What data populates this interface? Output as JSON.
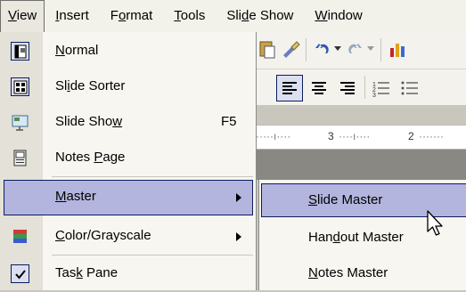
{
  "menubar": {
    "items": [
      {
        "label": "View",
        "mnemonic_before": "",
        "mnemonic": "V",
        "mnemonic_after": "iew",
        "open": true
      },
      {
        "label": "Insert",
        "mnemonic_before": "",
        "mnemonic": "I",
        "mnemonic_after": "nsert"
      },
      {
        "label": "Format",
        "mnemonic_before": "F",
        "mnemonic": "o",
        "mnemonic_after": "rmat"
      },
      {
        "label": "Tools",
        "mnemonic_before": "",
        "mnemonic": "T",
        "mnemonic_after": "ools"
      },
      {
        "label": "Slide Show",
        "mnemonic_before": "Sli",
        "mnemonic": "d",
        "mnemonic_after": "e Show"
      },
      {
        "label": "Window",
        "mnemonic_before": "",
        "mnemonic": "W",
        "mnemonic_after": "indow"
      }
    ]
  },
  "view_menu": {
    "items": [
      {
        "label_before": "",
        "mnemonic": "N",
        "label_after": "ormal",
        "icon": "normal-view-icon"
      },
      {
        "label_before": "Sl",
        "mnemonic": "i",
        "label_after": "de Sorter",
        "icon": "slide-sorter-icon"
      },
      {
        "label_before": "Slide Sho",
        "mnemonic": "w",
        "label_after": "",
        "shortcut": "F5",
        "icon": "slide-show-icon"
      },
      {
        "label_before": "Notes ",
        "mnemonic": "P",
        "label_after": "age",
        "icon": "notes-page-icon"
      },
      {
        "label_before": "",
        "mnemonic": "M",
        "label_after": "aster",
        "submenu": true,
        "highlighted": true
      },
      {
        "label_before": "",
        "mnemonic": "C",
        "label_after": "olor/Grayscale",
        "submenu": true,
        "icon": "color-grayscale-icon"
      },
      {
        "label_before": "Tas",
        "mnemonic": "k",
        "label_after": " Pane",
        "icon": "checkmark-icon",
        "checked": true
      }
    ]
  },
  "master_submenu": {
    "items": [
      {
        "label_before": "",
        "mnemonic": "S",
        "label_after": "lide Master",
        "highlighted": true
      },
      {
        "label_before": "Han",
        "mnemonic": "d",
        "label_after": "out Master"
      },
      {
        "label_before": "",
        "mnemonic": "N",
        "label_after": "otes Master"
      }
    ]
  },
  "ruler": {
    "marks": [
      "3",
      "2"
    ]
  },
  "colors": {
    "highlight": "#b3b5de",
    "highlight_border": "#0b1d5c",
    "menu_bg": "#f7f6f0",
    "gutter": "#e3e1d8"
  }
}
